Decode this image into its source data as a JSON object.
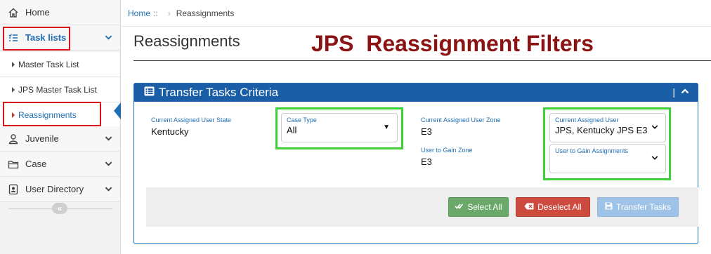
{
  "sidebar": {
    "home": {
      "label": "Home",
      "icon": "home-icon"
    },
    "task_lists": {
      "label": "Task lists",
      "icon": "list-icon"
    },
    "sub_items": [
      {
        "label": "Master Task List"
      },
      {
        "label": "JPS Master Task List"
      },
      {
        "label": "Reassignments"
      }
    ],
    "juvenile": {
      "label": "Juvenile",
      "icon": "user-icon"
    },
    "case": {
      "label": "Case",
      "icon": "folder-icon"
    },
    "user_directory": {
      "label": "User Directory",
      "icon": "contact-book-icon"
    },
    "collapse_glyph": "«"
  },
  "breadcrumb": {
    "home": "Home",
    "sep": "::",
    "arrow": "›",
    "current": "Reassignments"
  },
  "page": {
    "title": "Reassignments",
    "annotation": "JPS  Reassignment Filters"
  },
  "panel": {
    "title": "Transfer Tasks Criteria",
    "ctrl_sep": "|",
    "ctrl_up": "⌃"
  },
  "filters": {
    "current_user_state": {
      "label": "Current Assigned User State",
      "value": "Kentucky"
    },
    "case_type": {
      "label": "Case Type",
      "value": "All"
    },
    "current_user_zone": {
      "label": "Current Assigned User Zone",
      "value": "E3"
    },
    "gain_zone": {
      "label": "User to Gain Zone",
      "value": "E3"
    },
    "current_user": {
      "label": "Current Assigned User",
      "value": "JPS, Kentucky JPS E3"
    },
    "gain_user": {
      "label": "User to Gain Assignments",
      "value": ""
    }
  },
  "buttons": {
    "select_all": "Select All",
    "deselect_all": "Deselect All",
    "transfer": "Transfer Tasks"
  },
  "colors": {
    "accent": "#1f6fb5",
    "panel_header": "#1a5ea8",
    "annotation": "#8b1313",
    "highlight_red": "#d9141b",
    "highlight_green": "#3fd13a",
    "btn_green": "#6aa96a",
    "btn_red": "#cd4b3e",
    "btn_blue_disabled": "#9ec3e6"
  }
}
